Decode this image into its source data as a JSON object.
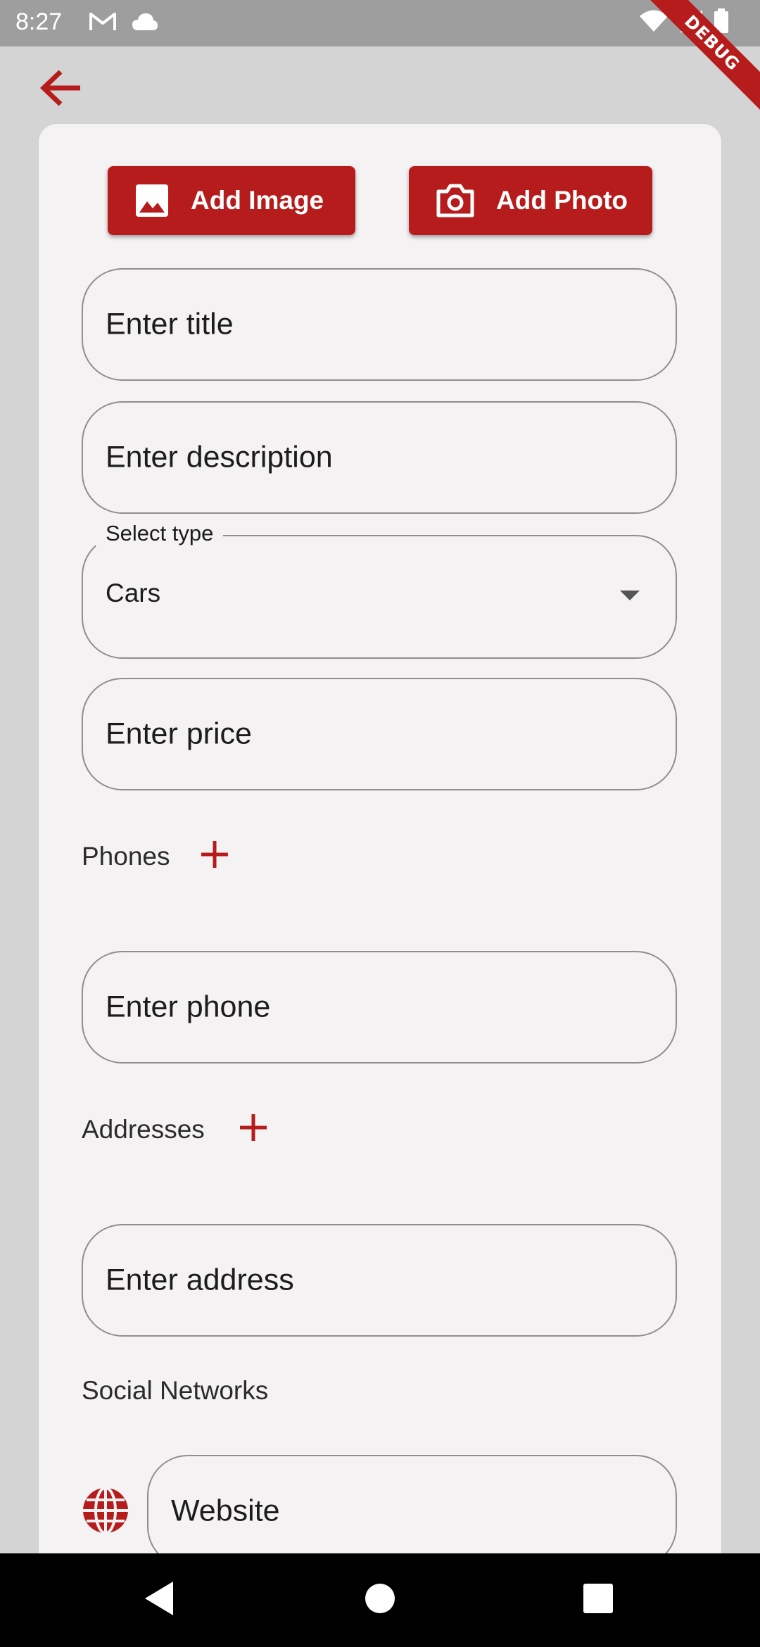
{
  "status_bar": {
    "time": "8:27"
  },
  "debug_banner": "DEBUG",
  "buttons": {
    "add_image": "Add Image",
    "add_photo": "Add Photo"
  },
  "fields": {
    "title_placeholder": "Enter title",
    "description_placeholder": "Enter description",
    "type_label": "Select type",
    "type_value": "Cars",
    "price_placeholder": "Enter price",
    "phone_placeholder": "Enter phone",
    "address_placeholder": "Enter address",
    "website_placeholder": "Website"
  },
  "sections": {
    "phones": "Phones",
    "addresses": "Addresses",
    "social_networks": "Social Networks"
  },
  "colors": {
    "accent": "#b71c1c",
    "background": "#d4d4d4",
    "card": "#f4f2f3"
  },
  "icons": [
    "back-arrow-icon",
    "image-icon",
    "camera-icon",
    "plus-icon",
    "globe-icon",
    "dropdown-caret-icon"
  ]
}
